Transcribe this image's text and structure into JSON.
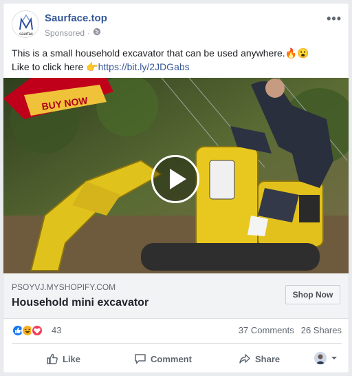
{
  "post": {
    "page_name": "Saurface.top",
    "avatar_text": "saurfac",
    "sponsored": "Sponsored",
    "sponsored_sep": "·",
    "more": "•••",
    "text_line1": "This is a small household excavator that can be used anywhere.🔥😮",
    "text_line2_prefix": "Like to click here 👉",
    "link_text": "https://bit.ly/2JDGabs",
    "banner_text": "BUY NOW"
  },
  "link_preview": {
    "domain": "PSOYVJ.MYSHOPIFY.COM",
    "headline": "Household mini excavator",
    "cta": "Shop Now"
  },
  "reactions": {
    "count": "43",
    "comments": "37 Comments",
    "shares": "26 Shares"
  },
  "actions": {
    "like": "Like",
    "comment": "Comment",
    "share": "Share"
  },
  "colors": {
    "brand_blue": "#365899",
    "link_blue": "#385898",
    "like_blue": "#1877f2",
    "love_red": "#f33e58",
    "haha_yellow": "#f7b125"
  },
  "icons": [
    "globe-icon",
    "play-icon",
    "like-reaction-icon",
    "haha-reaction-icon",
    "love-reaction-icon",
    "thumb-up-icon",
    "comment-icon",
    "share-icon",
    "chevron-down-icon"
  ]
}
